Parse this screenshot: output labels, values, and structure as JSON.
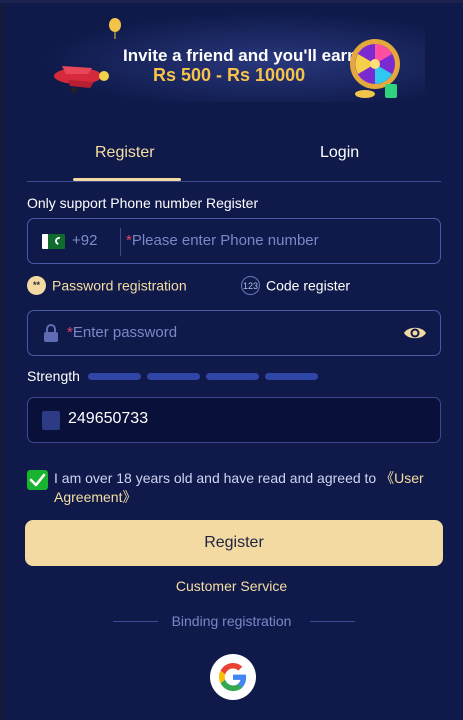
{
  "banner": {
    "line1": "Invite a friend and you'll earn",
    "line2": "Rs 500 - Rs 10000"
  },
  "tabs": [
    {
      "label": "Register",
      "active": true
    },
    {
      "label": "Login",
      "active": false
    }
  ],
  "form": {
    "only_support": "Only support Phone number Register",
    "phone": {
      "dial_code": "+92",
      "placeholder": "Please enter Phone number",
      "required_mark": "*"
    },
    "options": [
      {
        "label": "Password registration",
        "icon": "**",
        "selected": true
      },
      {
        "label": "Code register",
        "icon": "123",
        "selected": false
      }
    ],
    "password": {
      "placeholder": "Enter password",
      "required_mark": "*"
    },
    "strength_label": "Strength",
    "captcha_value": "249650733",
    "agreement": {
      "text": "I am over 18 years old and have read and agreed to ",
      "link": "《User Agreement》",
      "checked": true
    },
    "register_label": "Register",
    "customer_service": "Customer Service",
    "binding_label": "Binding registration"
  },
  "colors": {
    "background": "#0f1a4a",
    "accent": "#f3d9a2",
    "checkbox": "#19b42f"
  }
}
